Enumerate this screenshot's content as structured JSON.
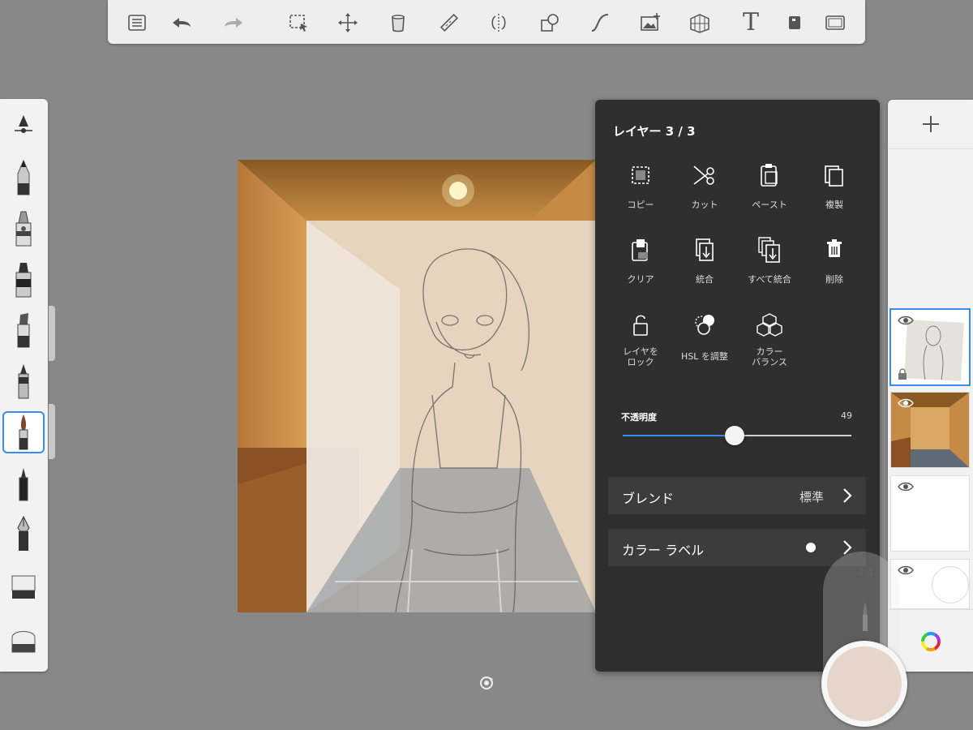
{
  "toolbar": {
    "icons": [
      "list-icon",
      "undo-icon",
      "redo-icon",
      "selection-icon",
      "transform-icon",
      "fill-bucket-icon",
      "ruler-icon",
      "symmetry-icon",
      "shapes-icon",
      "curve-icon",
      "add-image-icon",
      "perspective-icon",
      "text-icon",
      "layer-menu-icon",
      "fullscreen-icon"
    ],
    "text_tool": "T"
  },
  "brushes": [
    "pencil",
    "airbrush",
    "marker",
    "chisel-marker",
    "ballpoint",
    "paintbrush",
    "ink-pen",
    "fountain-pen",
    "eraser-hard",
    "eraser-soft"
  ],
  "canvas": {
    "description_colors": {
      "wall": "#c58a45",
      "ceiling": "#8a5a25",
      "floor": "#6f7a86"
    }
  },
  "layer_menu": {
    "title": "レイヤー 3 / 3",
    "actions": [
      {
        "label": "コピー",
        "icon": "copy-icon"
      },
      {
        "label": "カット",
        "icon": "scissors-icon"
      },
      {
        "label": "ペースト",
        "icon": "paste-icon"
      },
      {
        "label": "複製",
        "icon": "duplicate-icon"
      },
      {
        "label": "クリア",
        "icon": "clear-icon"
      },
      {
        "label": "統合",
        "icon": "merge-icon"
      },
      {
        "label": "すべて統合",
        "icon": "merge-all-icon"
      },
      {
        "label": "削除",
        "icon": "trash-icon"
      },
      {
        "label": "レイヤを\nロック",
        "icon": "lock-icon"
      },
      {
        "label": "HSL を調整",
        "icon": "hsl-icon"
      },
      {
        "label": "カラー\nバランス",
        "icon": "color-balance-icon"
      }
    ],
    "opacity": {
      "label": "不透明度",
      "value": "49",
      "fraction": 0.49
    },
    "blend": {
      "label": "ブレンド",
      "value": "標準"
    },
    "color_label": {
      "label": "カラー ラベル"
    }
  },
  "layers": {
    "add_label": "+",
    "items": [
      {
        "name": "layer-sketch",
        "selected": true
      },
      {
        "name": "layer-hallway",
        "selected": false
      },
      {
        "name": "layer-empty",
        "selected": false
      },
      {
        "name": "layer-base",
        "selected": false
      }
    ]
  },
  "puck": {
    "size_value": "4.4"
  },
  "accent_color": "#3a8df0"
}
